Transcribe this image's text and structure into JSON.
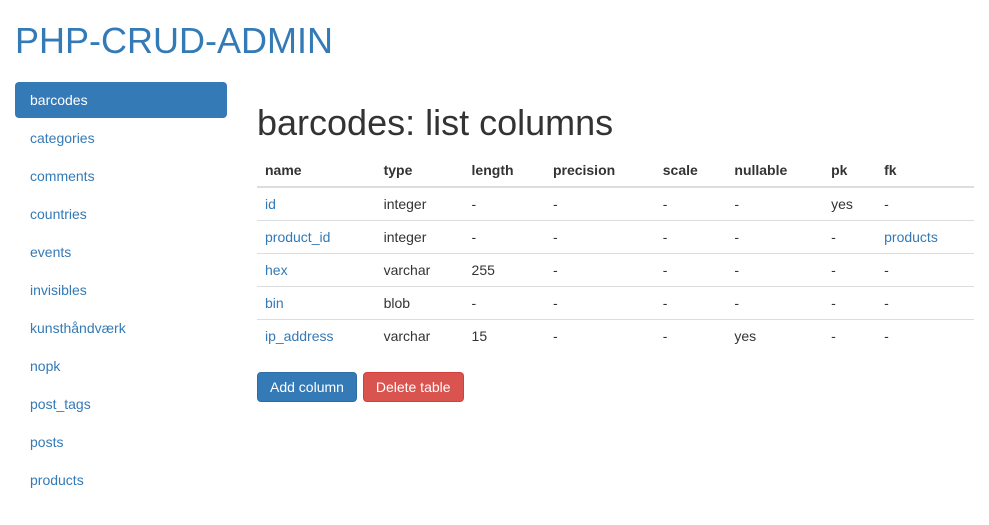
{
  "header": {
    "title": "PHP-CRUD-ADMIN"
  },
  "sidebar": {
    "items": [
      {
        "label": "barcodes",
        "active": true
      },
      {
        "label": "categories",
        "active": false
      },
      {
        "label": "comments",
        "active": false
      },
      {
        "label": "countries",
        "active": false
      },
      {
        "label": "events",
        "active": false
      },
      {
        "label": "invisibles",
        "active": false
      },
      {
        "label": "kunsthåndværk",
        "active": false
      },
      {
        "label": "nopk",
        "active": false
      },
      {
        "label": "post_tags",
        "active": false
      },
      {
        "label": "posts",
        "active": false
      },
      {
        "label": "products",
        "active": false
      }
    ]
  },
  "content": {
    "title": "barcodes: list columns",
    "headers": [
      "name",
      "type",
      "length",
      "precision",
      "scale",
      "nullable",
      "pk",
      "fk"
    ],
    "rows": [
      {
        "name": "id",
        "type": "integer",
        "length": "-",
        "precision": "-",
        "scale": "-",
        "nullable": "-",
        "pk": "yes",
        "fk": "-",
        "fk_link": false
      },
      {
        "name": "product_id",
        "type": "integer",
        "length": "-",
        "precision": "-",
        "scale": "-",
        "nullable": "-",
        "pk": "-",
        "fk": "products",
        "fk_link": true
      },
      {
        "name": "hex",
        "type": "varchar",
        "length": "255",
        "precision": "-",
        "scale": "-",
        "nullable": "-",
        "pk": "-",
        "fk": "-",
        "fk_link": false
      },
      {
        "name": "bin",
        "type": "blob",
        "length": "-",
        "precision": "-",
        "scale": "-",
        "nullable": "-",
        "pk": "-",
        "fk": "-",
        "fk_link": false
      },
      {
        "name": "ip_address",
        "type": "varchar",
        "length": "15",
        "precision": "-",
        "scale": "-",
        "nullable": "yes",
        "pk": "-",
        "fk": "-",
        "fk_link": false
      }
    ],
    "buttons": {
      "add": "Add column",
      "delete": "Delete table"
    }
  }
}
